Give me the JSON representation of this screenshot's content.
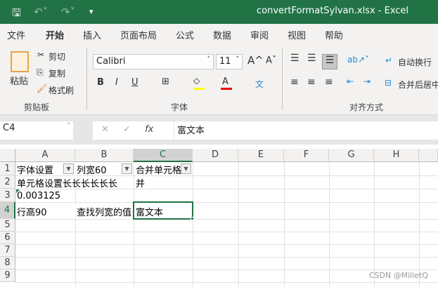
{
  "title": "convertFormatSylvan.xlsx  -  Excel",
  "tabs": [
    "文件",
    "开始",
    "插入",
    "页面布局",
    "公式",
    "数据",
    "审阅",
    "视图",
    "帮助"
  ],
  "clipboard": {
    "paste": "粘贴",
    "cut": "剪切",
    "copy": "复制",
    "format_painter": "格式刷",
    "group": "剪贴板"
  },
  "font": {
    "name": "Calibri",
    "size": "11",
    "bold": "B",
    "italic": "I",
    "underline": "U",
    "grow": "A^",
    "shrink": "Aˇ",
    "color_letter": "A",
    "phonetic": "文",
    "group": "字体"
  },
  "alignment": {
    "wrap": "自动换行",
    "merge": "合并后居中",
    "group": "对齐方式"
  },
  "formula_bar": {
    "name_box": "C4",
    "cancel": "✕",
    "enter": "✓",
    "fx": "fx",
    "value": "富文本"
  },
  "columns": [
    "A",
    "B",
    "C",
    "D",
    "E",
    "F",
    "G",
    "H"
  ],
  "rows": [
    "1",
    "2",
    "3",
    "4",
    "5",
    "6",
    "7",
    "8",
    "9"
  ],
  "cells": {
    "A1": "字体设置",
    "B1": "列宽60",
    "C1": "合并单元格",
    "A2": "单元格设置长长长长长长",
    "C2": "并",
    "A3": "0.003125",
    "A4": "行高90",
    "B4": "查找列宽的值",
    "C4": "富文本"
  },
  "watermark": "CSDN @MilletQ"
}
